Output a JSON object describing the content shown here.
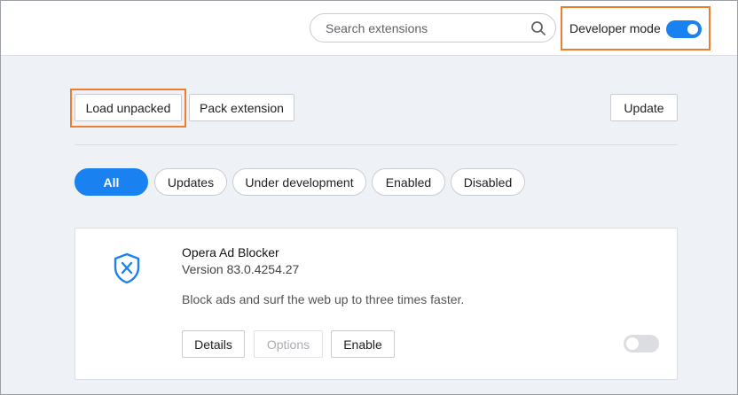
{
  "header": {
    "search_placeholder": "Search extensions",
    "developer_mode_label": "Developer mode",
    "developer_mode_on": true
  },
  "toolbar": {
    "load_unpacked": "Load unpacked",
    "pack_extension": "Pack extension",
    "update": "Update"
  },
  "filters": [
    {
      "label": "All",
      "active": true
    },
    {
      "label": "Updates",
      "active": false
    },
    {
      "label": "Under development",
      "active": false
    },
    {
      "label": "Enabled",
      "active": false
    },
    {
      "label": "Disabled",
      "active": false
    }
  ],
  "extension": {
    "name": "Opera Ad Blocker",
    "version": "Version 83.0.4254.27",
    "description": "Block ads and surf the web up to three times faster.",
    "details_label": "Details",
    "options_label": "Options",
    "enable_label": "Enable",
    "enabled": false,
    "icon": "shield-x-icon"
  },
  "colors": {
    "accent": "#1a82f0",
    "highlight": "#ef7d2e"
  }
}
